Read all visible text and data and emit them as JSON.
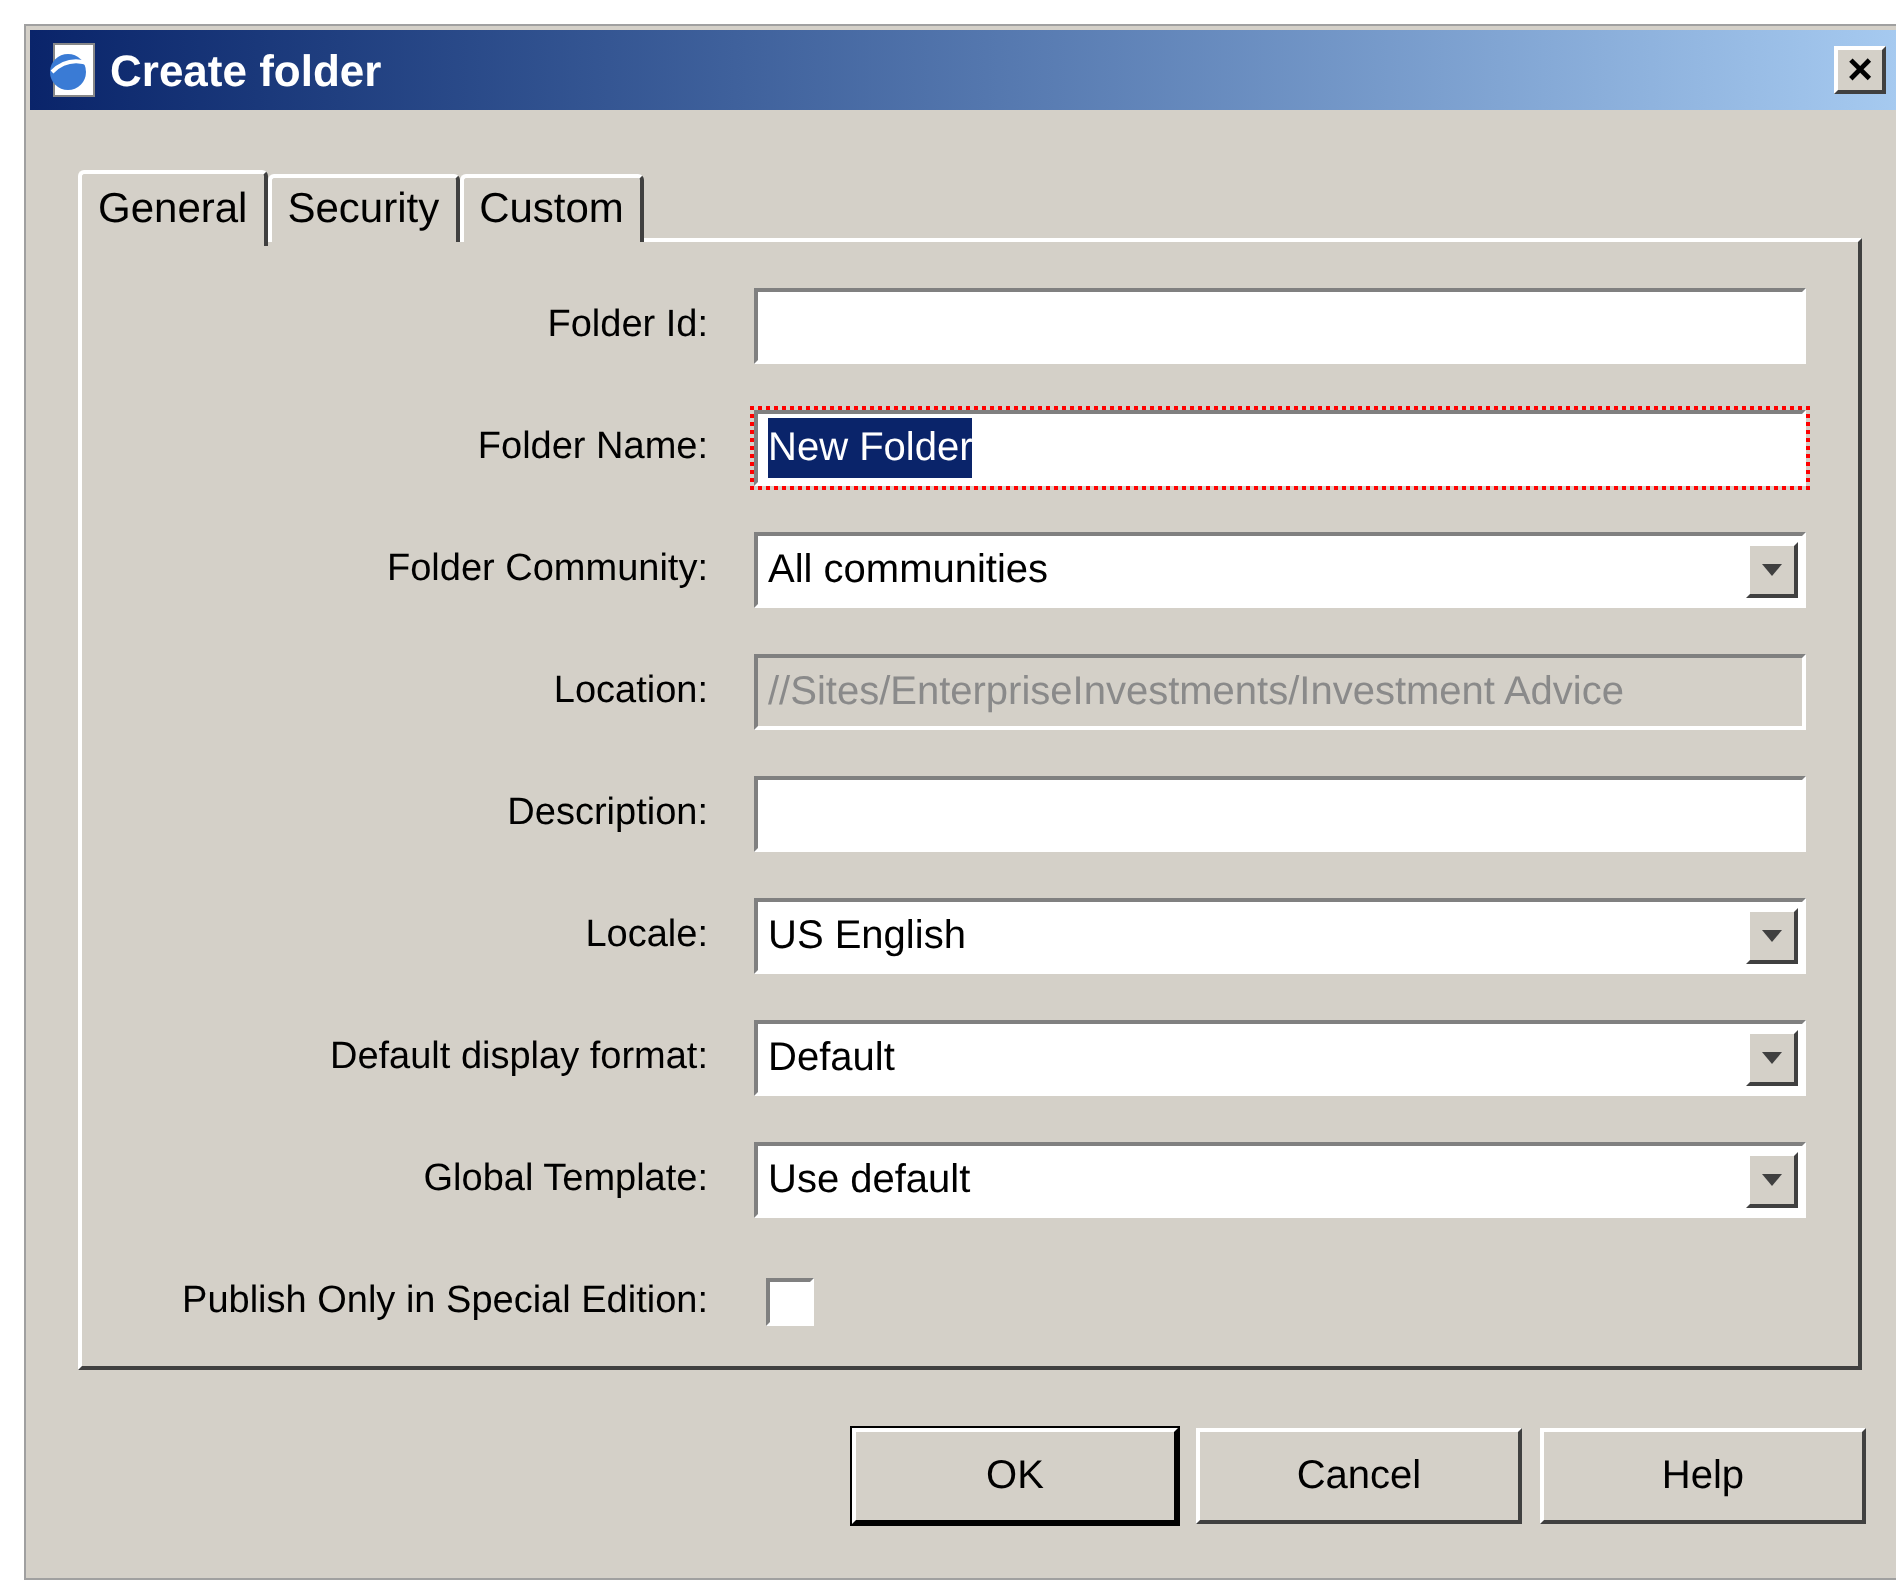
{
  "window": {
    "title": "Create folder",
    "close": "×"
  },
  "tabs": [
    {
      "label": "General",
      "selected": true
    },
    {
      "label": "Security",
      "selected": false
    },
    {
      "label": "Custom",
      "selected": false
    }
  ],
  "fields": [
    {
      "kind": "text",
      "label": "Folder Id:",
      "disabled": false,
      "focused": false
    },
    {
      "kind": "text",
      "label": "Folder Name:",
      "value": "New Folder",
      "disabled": false,
      "focused": true,
      "highlighted": true
    },
    {
      "kind": "select",
      "label": "Folder Community:",
      "value": "All communities",
      "disabled": false
    },
    {
      "kind": "text",
      "label": "Location:",
      "value": "//Sites/EnterpriseInvestments/Investment Advice",
      "disabled": true,
      "focused": false,
      "highlighted": false
    },
    {
      "kind": "text",
      "label": "Description:",
      "disabled": false,
      "focused": false
    },
    {
      "kind": "select",
      "label": "Locale:",
      "value": "US English",
      "disabled": false
    },
    {
      "kind": "select",
      "label": "Default display format:",
      "value": "Default",
      "disabled": false
    },
    {
      "kind": "select",
      "label": "Global Template:",
      "value": "Use default",
      "disabled": false
    },
    {
      "kind": "checkbox",
      "label": "Publish Only in Special Edition:",
      "checked": false
    }
  ],
  "buttons": [
    {
      "label": "OK",
      "default": true
    },
    {
      "label": "Cancel",
      "default": false
    },
    {
      "label": "Help",
      "default": false
    }
  ]
}
